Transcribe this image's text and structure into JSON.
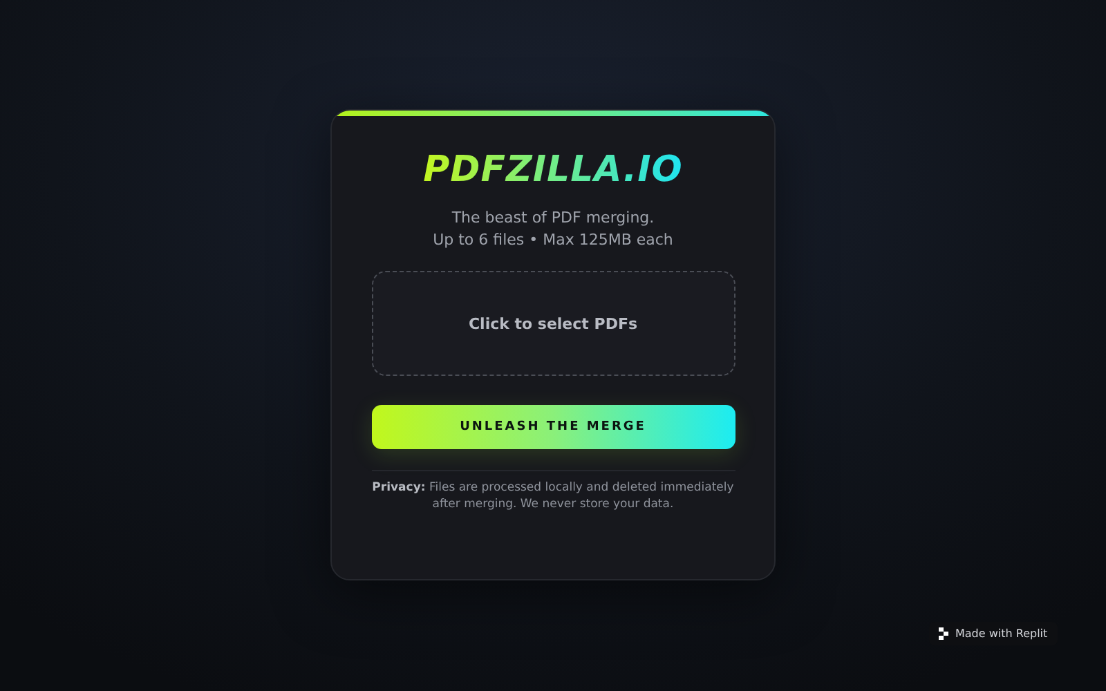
{
  "logo": "PDFZILLA.IO",
  "tagline": [
    "The beast of PDF merging.",
    "Up to 6 files • Max 125MB each"
  ],
  "dropzone": {
    "label": "Click to select PDFs"
  },
  "merge_button": "UNLEASH THE MERGE",
  "privacy_note": "**Privacy:** Files are processed locally and deleted immediately after merging. We never store your data.",
  "badge": "Made with Replit"
}
